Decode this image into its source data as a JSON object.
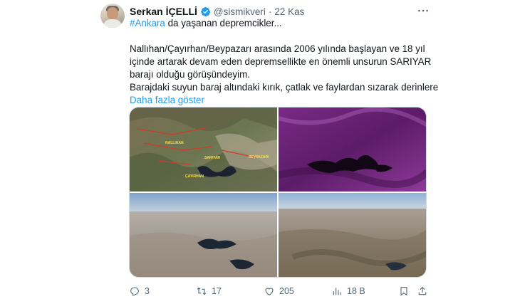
{
  "author": {
    "name": "Serkan İÇELLİ",
    "handle": "@sismikveri",
    "separator": "·",
    "time": "22 Kas"
  },
  "icons": {
    "verified": "verified-badge-icon",
    "more": "more-dots-icon",
    "reply": "reply-icon",
    "retweet": "retweet-icon",
    "like": "like-icon",
    "views": "views-icon",
    "bookmark": "bookmark-icon",
    "share": "share-icon"
  },
  "colors": {
    "accent": "#1d9bf0",
    "secondary_text": "#536471"
  },
  "tweet": {
    "hashtag": "#Ankara",
    "line1_rest": " da yaşanan depremcikler...",
    "line2": "Nallıhan/Çayırhan/Beypazarı arasında 2006 yılında başlayan ve 18 yıl",
    "line3": "içinde artarak devam eden depremsellikte en önemli unsurun SARIYAR",
    "line4": "barajı olduğu görüşündeyim.",
    "line5": "Barajdaki suyun baraj  altındaki kırık, çatlak ve faylardan sızarak derinlere",
    "show_more": "Daha fazla göster"
  },
  "media": {
    "map_labels": {
      "nallihan": "NALLIHAN",
      "beypazari": "BEYPAZARI",
      "sariyar": "SARIYAR",
      "cayirhan": "ÇAYIRHAN"
    }
  },
  "actions": {
    "replies": "3",
    "retweets": "17",
    "likes": "205",
    "views": "18 B"
  }
}
